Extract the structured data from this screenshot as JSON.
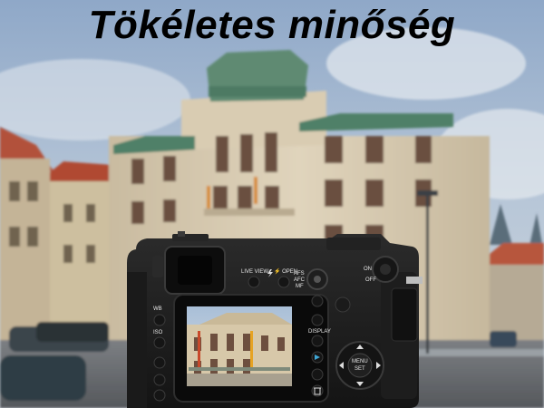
{
  "headline": "Tökéletes minőség",
  "camera": {
    "labels": {
      "live_view": "LIVE VIEW",
      "open": "⚡ OPEN",
      "afs": "AFS",
      "afc": "AFC",
      "mf": "MF",
      "on": "ON",
      "off": "OFF",
      "wb": "WB",
      "iso": "ISO",
      "display": "DISPLAY",
      "menu": "MENU",
      "set": "SET"
    }
  },
  "icons": {
    "play": "play-icon",
    "trash": "trash-icon",
    "flash": "flash-icon",
    "dpad": "dpad-icon"
  }
}
